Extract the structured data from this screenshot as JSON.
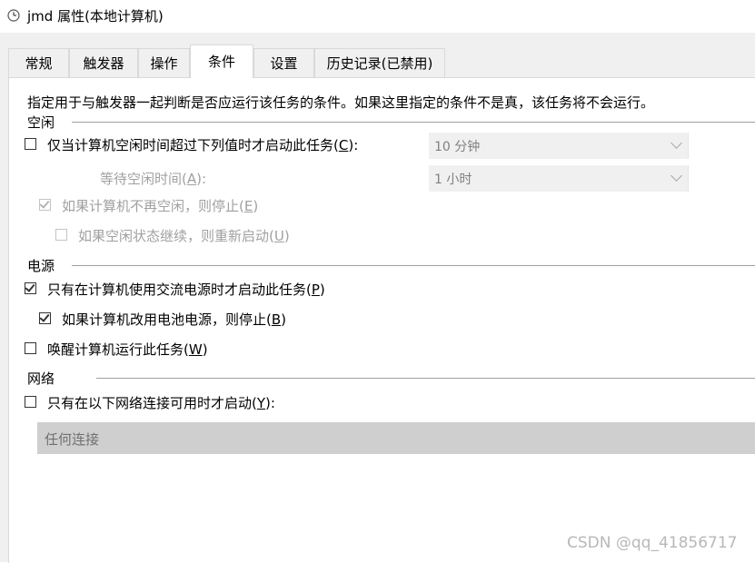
{
  "window": {
    "title": "jmd 属性(本地计算机)",
    "icon": "clock-icon"
  },
  "tabs": [
    {
      "label": "常规",
      "active": false
    },
    {
      "label": "触发器",
      "active": false
    },
    {
      "label": "操作",
      "active": false
    },
    {
      "label": "条件",
      "active": true
    },
    {
      "label": "设置",
      "active": false
    },
    {
      "label": "历史记录(已禁用)",
      "active": false
    }
  ],
  "description": "指定用于与触发器一起判断是否应运行该任务的条件。如果这里指定的条件不是真，该任务将不会运行。",
  "idle": {
    "group_label": "空闲",
    "start_if_idle": {
      "label_pre": "仅当计算机空闲时间超过下列值时才启动此任务(",
      "key": "C",
      "label_post": "):",
      "checked": false
    },
    "idle_for_value": "10 分钟",
    "wait_label_pre": "等待空闲时间(",
    "wait_key": "A",
    "wait_label_post": "):",
    "wait_value": "1 小时",
    "stop_if_not_idle": {
      "label_pre": "如果计算机不再空闲，则停止(",
      "key": "E",
      "label_post": ")",
      "checked": true,
      "enabled": false
    },
    "restart_if_idle": {
      "label_pre": "如果空闲状态继续，则重新启动(",
      "key": "U",
      "label_post": ")",
      "checked": false,
      "enabled": false
    }
  },
  "power": {
    "group_label": "电源",
    "ac_only": {
      "label_pre": "只有在计算机使用交流电源时才启动此任务(",
      "key": "P",
      "label_post": ")",
      "checked": true
    },
    "stop_on_battery": {
      "label_pre": "如果计算机改用电池电源，则停止(",
      "key": "B",
      "label_post": ")",
      "checked": true
    },
    "wake_to_run": {
      "label_pre": "唤醒计算机运行此任务(",
      "key": "W",
      "label_post": ")",
      "checked": false
    }
  },
  "network": {
    "group_label": "网络",
    "only_if_network": {
      "label_pre": "只有在以下网络连接可用时才启动(",
      "key": "Y",
      "label_post": "):",
      "checked": false
    },
    "connection_value": "任何连接"
  },
  "watermark": "CSDN @qq_41856717"
}
